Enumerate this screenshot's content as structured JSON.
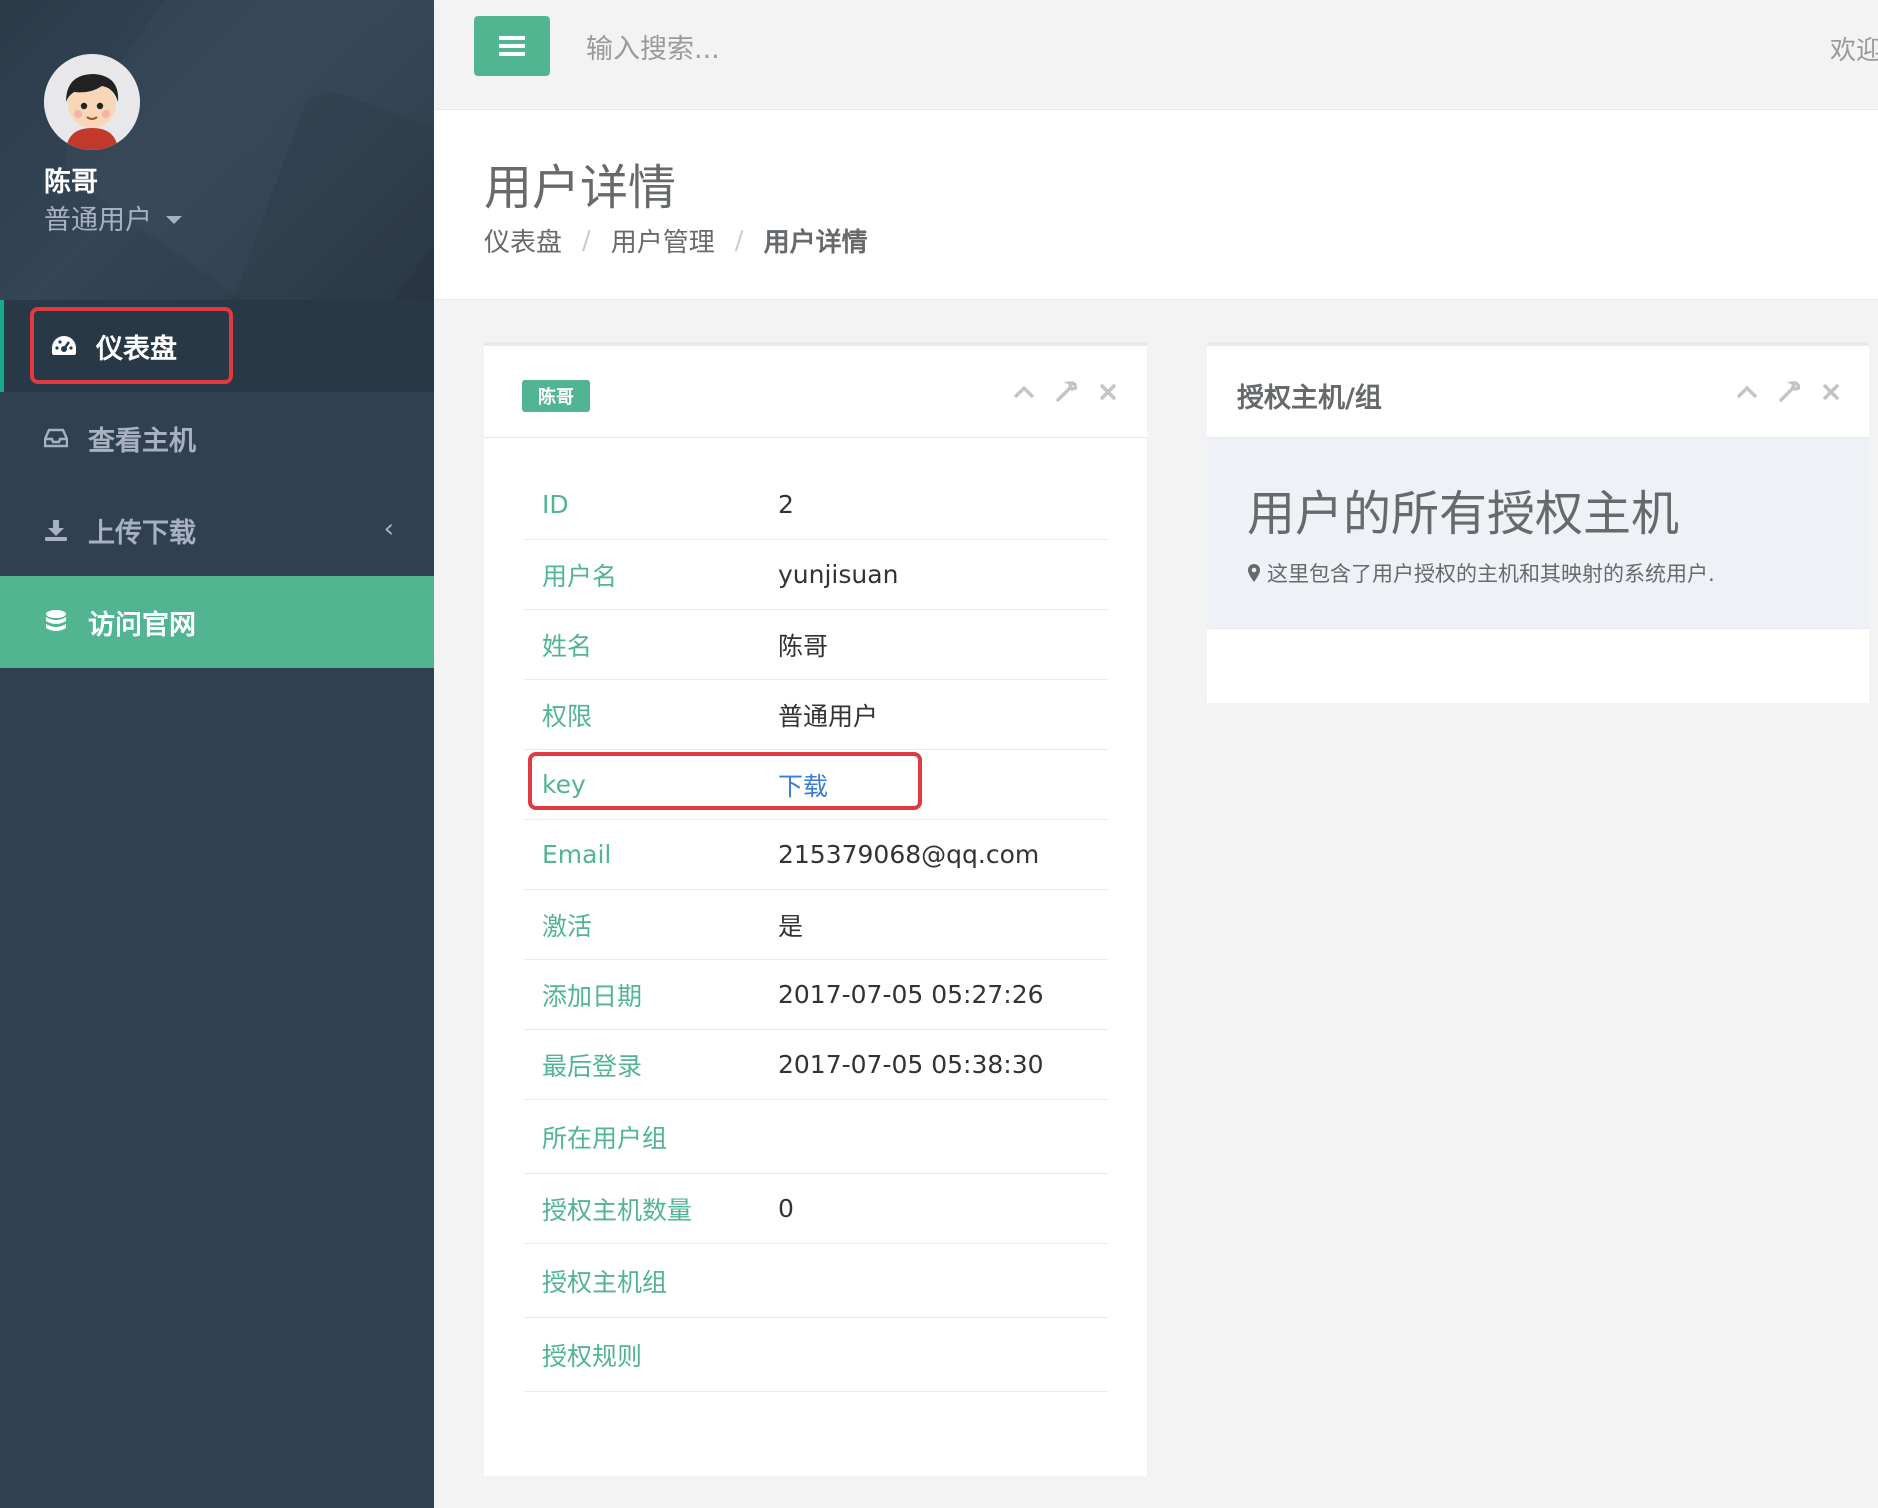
{
  "sidebar": {
    "profile": {
      "name": "陈哥",
      "role": "普通用户"
    },
    "items": [
      {
        "label": "仪表盘",
        "icon": "dashboard-icon"
      },
      {
        "label": "查看主机",
        "icon": "inbox-icon"
      },
      {
        "label": "上传下载",
        "icon": "download-icon",
        "arrow": "‹"
      },
      {
        "label": "访问官网",
        "icon": "database-icon"
      }
    ]
  },
  "topbar": {
    "search_placeholder": "输入搜索...",
    "welcome": "欢迎"
  },
  "page": {
    "title": "用户详情",
    "breadcrumb": [
      "仪表盘",
      "用户管理",
      "用户详情"
    ],
    "breadcrumb_sep": "/"
  },
  "user_panel": {
    "badge": "陈哥",
    "rows": [
      {
        "label": "ID",
        "value": "2"
      },
      {
        "label": "用户名",
        "value": "yunjisuan"
      },
      {
        "label": "姓名",
        "value": "陈哥"
      },
      {
        "label": "权限",
        "value": "普通用户"
      },
      {
        "label": "key",
        "value": "下载"
      },
      {
        "label": "Email",
        "value": "215379068@qq.com"
      },
      {
        "label": "激活",
        "value": "是"
      },
      {
        "label": "添加日期",
        "value": "2017-07-05 05:27:26"
      },
      {
        "label": "最后登录",
        "value": "2017-07-05 05:38:30"
      },
      {
        "label": "所在用户组",
        "value": ""
      },
      {
        "label": "授权主机数量",
        "value": "0"
      },
      {
        "label": "授权主机组",
        "value": ""
      },
      {
        "label": "授权规则",
        "value": ""
      }
    ]
  },
  "hosts_panel": {
    "title": "授权主机/组",
    "heading": "用户的所有授权主机",
    "description": "这里包含了用户授权的主机和其映射的系统用户."
  },
  "colors": {
    "sidebar_bg": "#2f4050",
    "accent": "#52b591",
    "highlight_box": "#e0393e",
    "link": "#3a7bd5"
  }
}
